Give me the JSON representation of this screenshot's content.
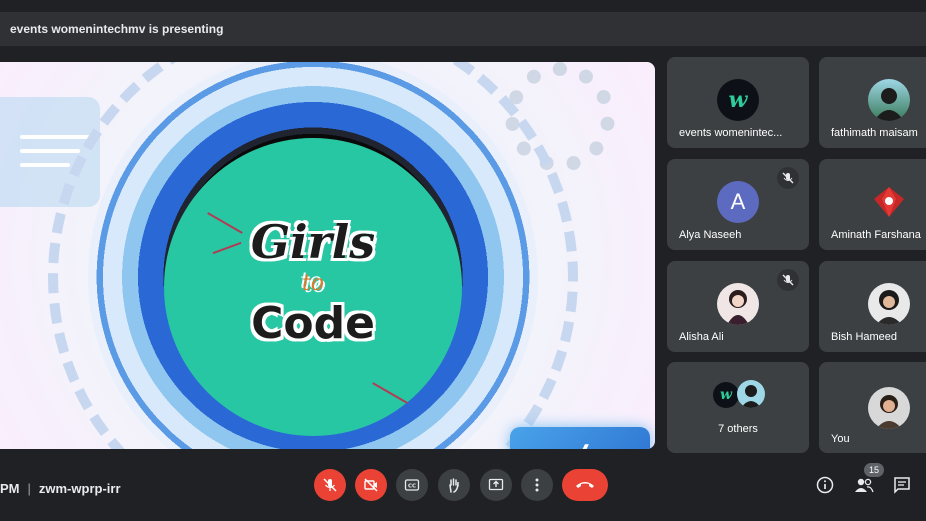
{
  "presenting": {
    "text": "events womenintechmv is presenting"
  },
  "slide": {
    "logo_line1": "Girls",
    "logo_line2": "to",
    "logo_line3": "Code",
    "code_symbol": "</>"
  },
  "participants": [
    {
      "name": "events womenintec...",
      "avatar_text": "w",
      "muted": false
    },
    {
      "name": "fathimath maisam",
      "muted": false
    },
    {
      "name": "Alya Naseeh",
      "avatar_text": "A",
      "muted": true
    },
    {
      "name": "Aminath Farshana",
      "muted": false
    },
    {
      "name": "Alisha Ali",
      "muted": true
    },
    {
      "name": "Bish Hameed",
      "muted": false
    },
    {
      "name": "7 others",
      "avatar_text": "w",
      "muted": false
    },
    {
      "name": "You",
      "muted": false
    }
  ],
  "bottom": {
    "time_suffix": "PM",
    "meeting_code": "zwm-wprp-irr",
    "participant_count": "15"
  },
  "colors": {
    "accent_red": "#ea4335",
    "tile_bg": "#3c4043",
    "bar_bg": "#202124",
    "avatar_purple": "#5c6bc0",
    "logo_teal": "#28c7a3"
  }
}
